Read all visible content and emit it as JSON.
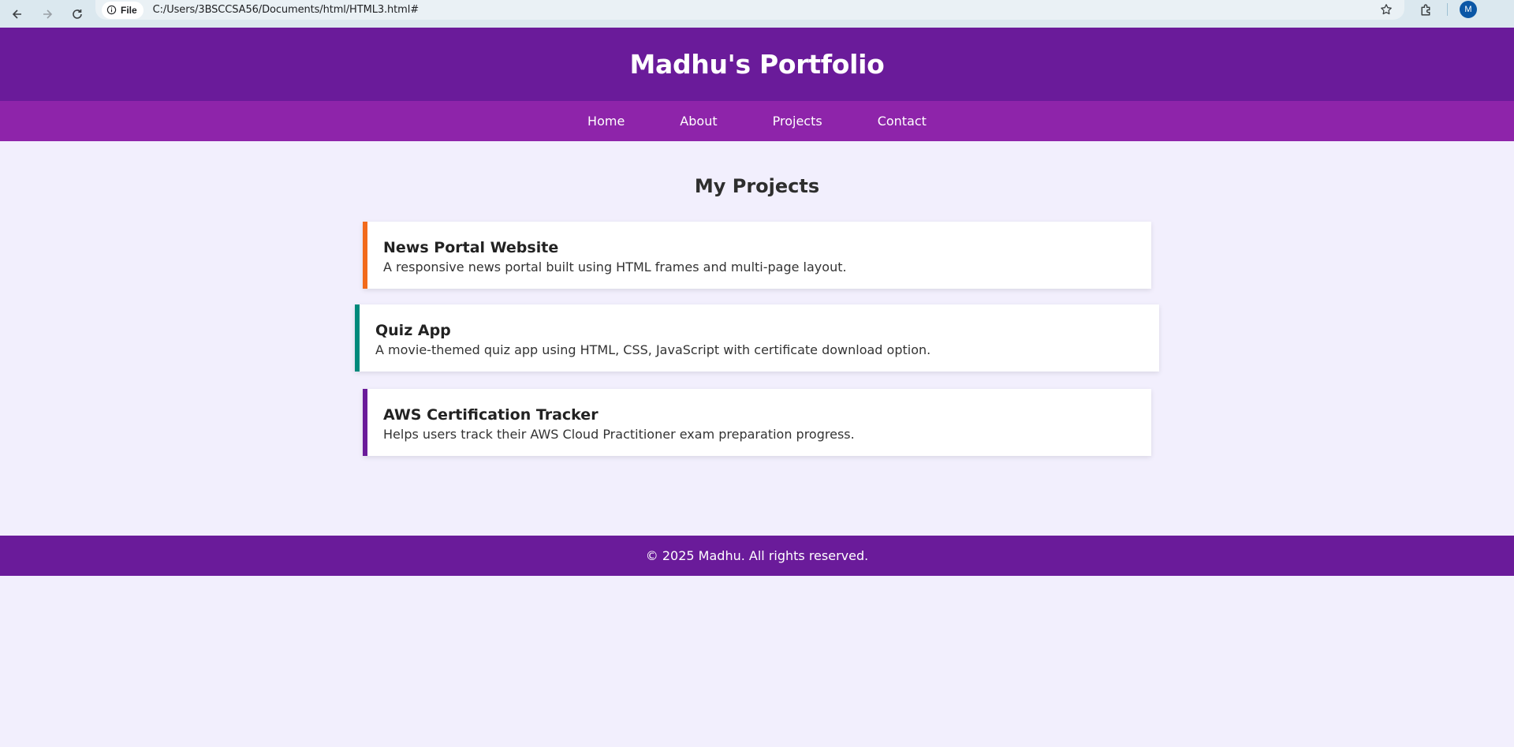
{
  "browser": {
    "file_chip_label": "File",
    "url": "C:/Users/3BSCCSA56/Documents/html/HTML3.html#",
    "avatar_initial": "M",
    "icons": [
      "back-icon",
      "forward-icon",
      "reload-icon",
      "info-icon",
      "star-icon",
      "extensions-icon"
    ]
  },
  "header": {
    "title": "Madhu's Portfolio"
  },
  "nav": {
    "items": [
      {
        "label": "Home"
      },
      {
        "label": "About"
      },
      {
        "label": "Projects"
      },
      {
        "label": "Contact"
      }
    ]
  },
  "main": {
    "section_title": "My Projects",
    "projects": [
      {
        "title": "News Portal Website",
        "description": "A responsive news portal built using HTML frames and multi-page layout.",
        "accent": "#f26a1b"
      },
      {
        "title": "Quiz App",
        "description": "A movie-themed quiz app using HTML, CSS, JavaScript with certificate download option.",
        "accent": "#00897b"
      },
      {
        "title": "AWS Certification Tracker",
        "description": "Helps users track their AWS Cloud Practitioner exam preparation progress.",
        "accent": "#6a1b9a"
      }
    ]
  },
  "footer": {
    "text": "© 2025 Madhu. All rights reserved."
  },
  "colors": {
    "header_bg": "#6a1b9a",
    "nav_bg": "#8e24aa",
    "page_bg": "#f2effd",
    "footer_bg": "#6a1b9a"
  }
}
